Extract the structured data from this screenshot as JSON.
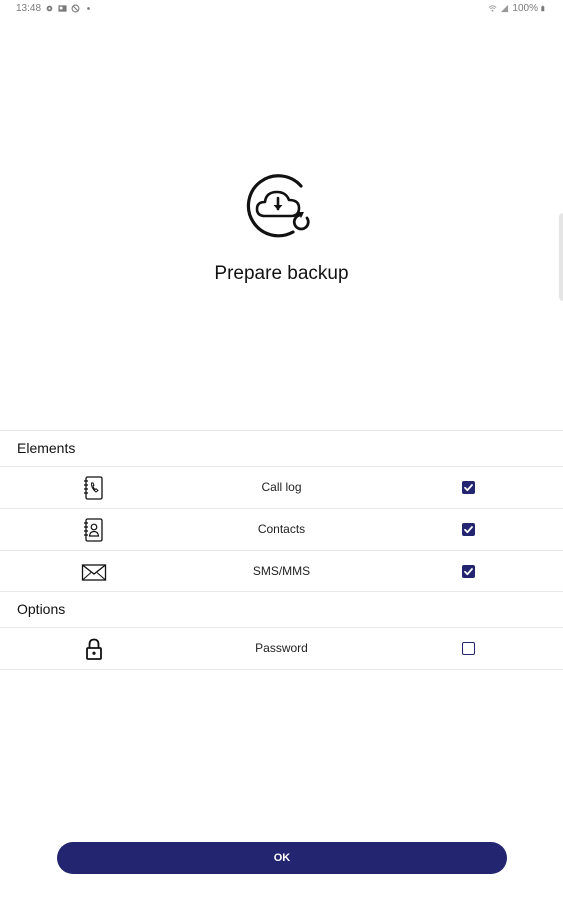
{
  "status_bar": {
    "time": "13:48",
    "battery": "100%",
    "left_icons": [
      "gear-icon",
      "photo-icon",
      "block-icon",
      "dot-icon"
    ],
    "right_icons": [
      "wifi-icon",
      "signal-icon",
      "battery-icon"
    ]
  },
  "header": {
    "icon": "cloud-download-restore-icon",
    "title": "Prepare backup"
  },
  "sections": {
    "elements": {
      "title": "Elements",
      "items": [
        {
          "label": "Call log",
          "icon": "call-log-icon",
          "checked": true
        },
        {
          "label": "Contacts",
          "icon": "contacts-icon",
          "checked": true
        },
        {
          "label": "SMS/MMS",
          "icon": "envelope-icon",
          "checked": true
        }
      ]
    },
    "options": {
      "title": "Options",
      "items": [
        {
          "label": "Password",
          "icon": "lock-icon",
          "checked": false
        }
      ]
    }
  },
  "footer": {
    "ok_label": "OK"
  },
  "colors": {
    "accent": "#232570",
    "divider": "#e8e8e8",
    "background": "#ffffff"
  }
}
